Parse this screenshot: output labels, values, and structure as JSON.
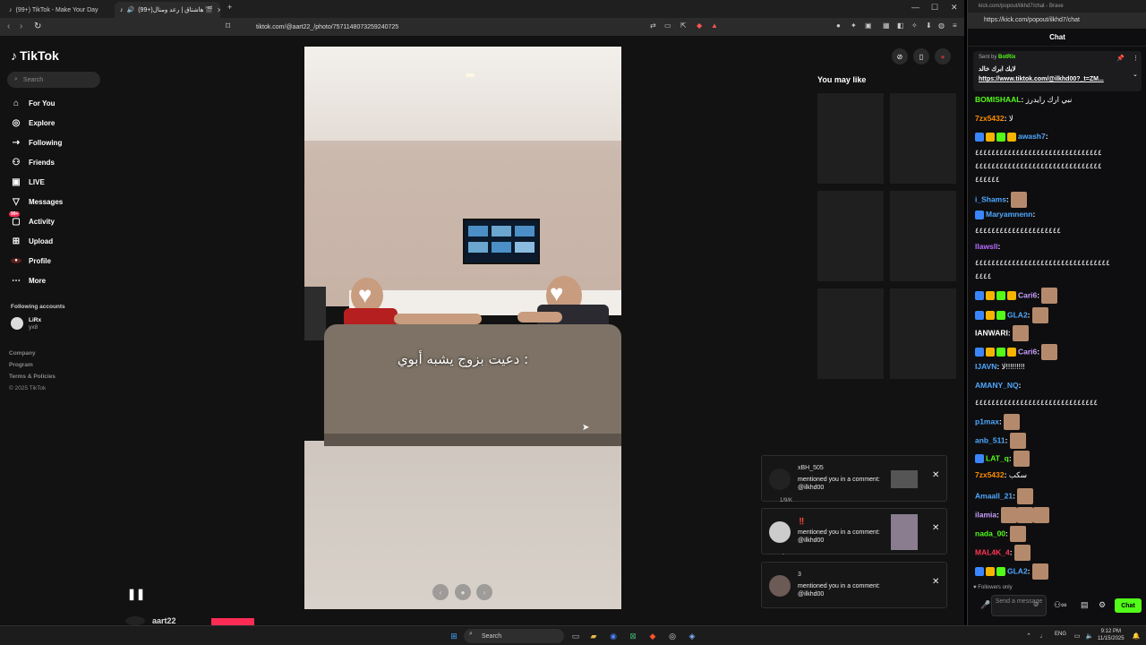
{
  "browser": {
    "tabs": [
      {
        "label": "(99+) TikTok - Make Your Day"
      },
      {
        "label": "(99+)هاشتاق | رعد ومنال 🎬"
      }
    ],
    "url": "tiktok.com/@aart22_/photo/7571148073259240725"
  },
  "tiktok": {
    "logo": "TikTok",
    "search_placeholder": "Search",
    "nav": [
      {
        "label": "For You",
        "icon": "home-icon"
      },
      {
        "label": "Explore",
        "icon": "compass-icon"
      },
      {
        "label": "Following",
        "icon": "following-icon"
      },
      {
        "label": "Friends",
        "icon": "friends-icon"
      },
      {
        "label": "LIVE",
        "icon": "live-icon"
      },
      {
        "label": "Messages",
        "icon": "messages-icon"
      },
      {
        "label": "Activity",
        "icon": "activity-icon",
        "badge": "99+"
      },
      {
        "label": "Upload",
        "icon": "upload-icon"
      },
      {
        "label": "Profile",
        "icon": "profile-icon"
      },
      {
        "label": "More",
        "icon": "more-icon"
      }
    ],
    "following_title": "Following accounts",
    "following_account": {
      "name": "LiRx",
      "handle": "yx8"
    },
    "footer": [
      "Company",
      "Program",
      "Terms & Policies",
      "© 2025 TikTok"
    ],
    "overlay_text": "دعيت بزوج يشبه أبوي :",
    "creator": "aart22",
    "you_may_like": "You may like",
    "notifications": [
      {
        "name": "xBH_505",
        "message": "mentioned you in a comment: @ilkhd00"
      },
      {
        "name": "‼️",
        "message": "mentioned you in a comment: @ilkhd00"
      },
      {
        "name": "3",
        "message": "mentioned you in a comment: @ilkhd00"
      }
    ],
    "notif_partial": [
      "1/9/K",
      "-"
    ],
    "colors": {
      "brand_red": "#fe2c55",
      "bg": "#121212"
    }
  },
  "chat": {
    "window_title": "kick.com/popout/ilkhd7/chat - Brave",
    "url": "https://kick.com/popout/ilkhd7/chat",
    "header": "Chat",
    "pinned": {
      "sent_by_label": "Sent by",
      "sender": "BotRix",
      "text": "لايك ابرك خالد",
      "link": "https://www.tiktok.com/@ilkhd00?_t=ZM..."
    },
    "messages": [
      {
        "user": "BOMISHAAL",
        "color": "#53fc18",
        "text": "نبي ارك رايدرز"
      },
      {
        "user": "7zx5432",
        "color": "#ff8c00",
        "text": "لا"
      },
      {
        "user": "awash7",
        "color": "#4fa9ff",
        "text": ""
      },
      {
        "user": "",
        "color": "#fff",
        "text": "٤٤٤٤٤٤٤٤٤٤٤٤٤٤٤٤٤٤٤٤٤٤٤٤٤٤٤٤٤٤٤"
      },
      {
        "user": "",
        "color": "#fff",
        "text": "٤٤٤٤٤٤٤٤٤٤٤٤٤٤٤٤٤٤٤٤٤٤٤٤٤٤٤٤٤٤٤"
      },
      {
        "user": "",
        "color": "#fff",
        "text": "٤٤٤٤٤٤"
      },
      {
        "user": "i_Shams",
        "color": "#4fa9ff",
        "text": ""
      },
      {
        "user": "Maryamnenn",
        "color": "#4fa9ff",
        "text": ""
      },
      {
        "user": "",
        "color": "#fff",
        "text": "٤٤٤٤٤٤٤٤٤٤٤٤٤٤٤٤٤٤٤٤٤"
      },
      {
        "user": "llawsll",
        "color": "#b76bff",
        "text": ""
      },
      {
        "user": "",
        "color": "#fff",
        "text": "٤٤٤٤٤٤٤٤٤٤٤٤٤٤٤٤٤٤٤٤٤٤٤٤٤٤٤٤٤٤٤٤٤"
      },
      {
        "user": "",
        "color": "#fff",
        "text": "٤٤٤٤"
      },
      {
        "user": "Cari6",
        "color": "#c8a0ff",
        "text": ""
      },
      {
        "user": "GLA2",
        "color": "#4fa9ff",
        "text": ""
      },
      {
        "user": "IANWARI",
        "color": "#ffffff",
        "text": ""
      },
      {
        "user": "Cari6",
        "color": "#c8a0ff",
        "text": ""
      },
      {
        "user": "IJAVN",
        "color": "#4fa9ff",
        "text": "لا!!!!!!!!!"
      },
      {
        "user": "AMANY_NQ",
        "color": "#4fa9ff",
        "text": ""
      },
      {
        "user": "",
        "color": "#fff",
        "text": "٤٤٤٤٤٤٤٤٤٤٤٤٤٤٤٤٤٤٤٤٤٤٤٤٤٤٤٤٤٤"
      },
      {
        "user": "p1max",
        "color": "#4fa9ff",
        "text": ""
      },
      {
        "user": "anb_511",
        "color": "#4fa9ff",
        "text": ""
      },
      {
        "user": "LAT_q",
        "color": "#53fc18",
        "text": ""
      },
      {
        "user": "7zx5432",
        "color": "#ff8c00",
        "text": "سكب"
      },
      {
        "user": "Amaall_21",
        "color": "#4fa9ff",
        "text": ""
      },
      {
        "user": "ilamia",
        "color": "#c8a0ff",
        "text": ""
      },
      {
        "user": "nada_00",
        "color": "#53fc18",
        "text": ""
      },
      {
        "user": "MAL4K_4",
        "color": "#ff3355",
        "text": ""
      },
      {
        "user": "GLA2",
        "color": "#4fa9ff",
        "text": ""
      }
    ],
    "followers_only": "Followers only",
    "send_placeholder": "Send a message",
    "chat_button": "Chat",
    "colors": {
      "kick_green": "#53fc18"
    }
  },
  "taskbar": {
    "search": "Search",
    "lang": "ENG",
    "time": "9:12 PM",
    "date": "11/15/2025"
  }
}
